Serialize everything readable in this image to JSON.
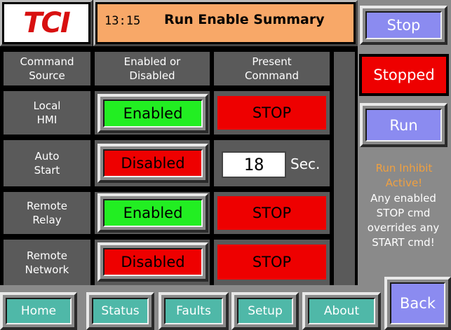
{
  "header": {
    "logo": "TCI",
    "time": "13:15",
    "title": "Run Enable Summary"
  },
  "table": {
    "columns": [
      "Command\nSource",
      "Enabled or\nDisabled",
      "Present\nCommand"
    ],
    "rows": [
      {
        "source": "Local\nHMI",
        "status": "Enabled",
        "command": "STOP"
      },
      {
        "source": "Auto\nStart",
        "status": "Disabled",
        "timer_value": "18",
        "timer_unit": "Sec."
      },
      {
        "source": "Remote\nRelay",
        "status": "Enabled",
        "command": "STOP"
      },
      {
        "source": "Remote\nNetwork",
        "status": "Disabled",
        "command": "STOP"
      }
    ]
  },
  "right_panel": {
    "stop_label": "Stop",
    "state": "Stopped",
    "run_label": "Run",
    "inhibit": "Run Inhibit\nActive!",
    "note": "Any enabled\nSTOP cmd\noverrides any\nSTART cmd!"
  },
  "nav": {
    "home": "Home",
    "status": "Status",
    "faults": "Faults",
    "setup": "Setup",
    "about": "About",
    "back": "Back"
  },
  "colors": {
    "header_bg": "#f8a868",
    "enabled": "#22ee22",
    "disabled": "#ee0000",
    "button": "#8b8bf0",
    "nav": "#4fb8a8",
    "inhibit_text": "#f0a040"
  },
  "icons": {
    "logo": "tci-logo"
  }
}
